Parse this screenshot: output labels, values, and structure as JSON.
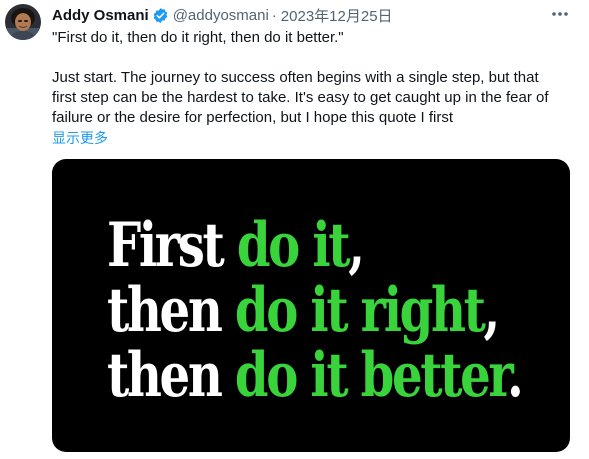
{
  "tweet": {
    "author_name": "Addy Osmani",
    "handle": "@addyosmani",
    "separator": "·",
    "date": "2023年12月25日",
    "more_icon": "more-horizontal-icon",
    "verified_icon": "verified-badge-icon",
    "text_line1": "\"First do it, then do it right, then do it better.\"",
    "text_para_line1": "Just start. The journey to success often begins with a single step, but that",
    "text_para_line2": "first step can be the hardest to take. It's easy to get caught up in the fear of",
    "text_para_line3": "failure or the desire for perfection, but I hope this quote I first",
    "show_more": "显示更多"
  },
  "media": {
    "line1_white": "First ",
    "line1_green": "do it",
    "line1_end": ",",
    "line2_white": "then ",
    "line2_green": "do it right",
    "line2_end": ",",
    "line3_white": "then ",
    "line3_green": "do it better",
    "line3_end": "."
  },
  "colors": {
    "accent": "#1d9bf0",
    "text_secondary": "#536471",
    "quote_green": "#39d43c",
    "media_bg": "#000000"
  }
}
